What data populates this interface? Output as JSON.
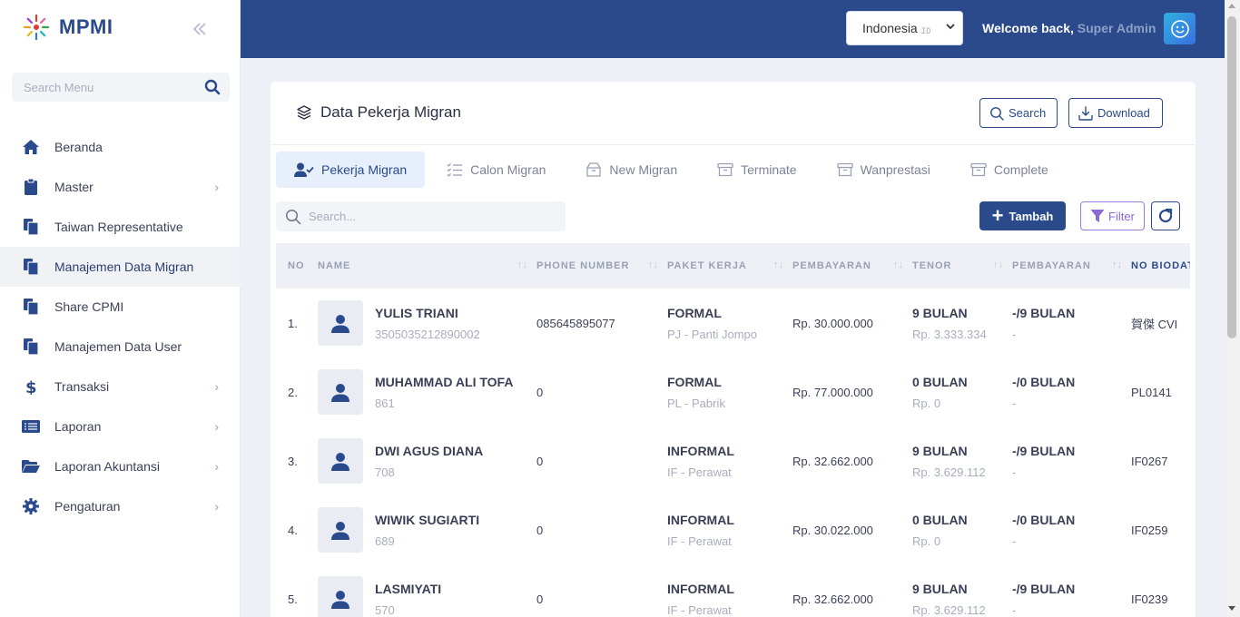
{
  "app": {
    "name": "MPMI",
    "collapse_icon": "double-chevron-left-icon"
  },
  "sidebar": {
    "search_placeholder": "Search Menu",
    "items": [
      {
        "label": "Beranda",
        "icon": "home-icon",
        "has_children": false,
        "active": false
      },
      {
        "label": "Master",
        "icon": "clipboard-icon",
        "has_children": true,
        "active": false
      },
      {
        "label": "Taiwan Representative",
        "icon": "copy-icon",
        "has_children": false,
        "active": false
      },
      {
        "label": "Manajemen Data Migran",
        "icon": "copy-icon",
        "has_children": false,
        "active": true
      },
      {
        "label": "Share CPMI",
        "icon": "copy-icon",
        "has_children": false,
        "active": false
      },
      {
        "label": "Manajemen Data User",
        "icon": "copy-icon",
        "has_children": false,
        "active": false
      },
      {
        "label": "Transaksi",
        "icon": "dollar-icon",
        "has_children": true,
        "active": false
      },
      {
        "label": "Laporan",
        "icon": "list-icon",
        "has_children": true,
        "active": false
      },
      {
        "label": "Laporan Akuntansi",
        "icon": "folder-open-icon",
        "has_children": true,
        "active": false
      },
      {
        "label": "Pengaturan",
        "icon": "gear-icon",
        "has_children": true,
        "active": false
      }
    ]
  },
  "topbar": {
    "language": "Indonesia",
    "language_code": "ID",
    "welcome": "Welcome back,",
    "user": "Super Admin"
  },
  "card": {
    "title": "Data Pekerja Migran",
    "search_button": "Search",
    "download_button": "Download",
    "tabs": [
      "Pekerja Migran",
      "Calon Migran",
      "New Migran",
      "Terminate",
      "Wanprestasi",
      "Complete"
    ],
    "active_tab": 0,
    "table_search_placeholder": "Search...",
    "add_button": "Tambah",
    "filter_button": "Filter"
  },
  "table": {
    "columns": [
      "NO",
      "NAME",
      "PHONE NUMBER",
      "PAKET KERJA",
      "PEMBAYARAN",
      "TENOR",
      "PEMBAYARAN",
      "NO BIODATA"
    ],
    "rows": [
      {
        "no": "1.",
        "name": "YULIS TRIANI",
        "id": "3505035212890002",
        "phone": "085645895077",
        "paket": "FORMAL",
        "paket_sub": "PJ - Panti Jompo",
        "pembayaran": "Rp. 30.000.000",
        "tenor": "9 BULAN",
        "tenor_sub": "Rp. 3.333.334",
        "pembayaran2": "-/9 BULAN",
        "pembayaran2_sub": "-",
        "biodata": "賀傑 CVI"
      },
      {
        "no": "2.",
        "name": "MUHAMMAD ALI TOFA",
        "id": "861",
        "phone": "0",
        "paket": "FORMAL",
        "paket_sub": "PL - Pabrik",
        "pembayaran": "Rp. 77.000.000",
        "tenor": "0 BULAN",
        "tenor_sub": "Rp. 0",
        "pembayaran2": "-/0 BULAN",
        "pembayaran2_sub": "-",
        "biodata": "PL0141"
      },
      {
        "no": "3.",
        "name": "DWI AGUS DIANA",
        "id": "708",
        "phone": "0",
        "paket": "INFORMAL",
        "paket_sub": "IF - Perawat",
        "pembayaran": "Rp. 32.662.000",
        "tenor": "9 BULAN",
        "tenor_sub": "Rp. 3.629.112",
        "pembayaran2": "-/9 BULAN",
        "pembayaran2_sub": "-",
        "biodata": "IF0267"
      },
      {
        "no": "4.",
        "name": "WIWIK SUGIARTI",
        "id": "689",
        "phone": "0",
        "paket": "INFORMAL",
        "paket_sub": "IF - Perawat",
        "pembayaran": "Rp. 30.022.000",
        "tenor": "0 BULAN",
        "tenor_sub": "Rp. 0",
        "pembayaran2": "-/0 BULAN",
        "pembayaran2_sub": "-",
        "biodata": "IF0259"
      },
      {
        "no": "5.",
        "name": "LASMIYATI",
        "id": "570",
        "phone": "0",
        "paket": "INFORMAL",
        "paket_sub": "IF - Perawat",
        "pembayaran": "Rp. 32.662.000",
        "tenor": "9 BULAN",
        "tenor_sub": "Rp. 3.629.112",
        "pembayaran2": "-/9 BULAN",
        "pembayaran2_sub": "-",
        "biodata": "IF0239"
      }
    ]
  },
  "colors": {
    "primary": "#2a4a8c",
    "filter_accent": "#8a6bd6",
    "active_tab_bg": "#e6effb"
  }
}
